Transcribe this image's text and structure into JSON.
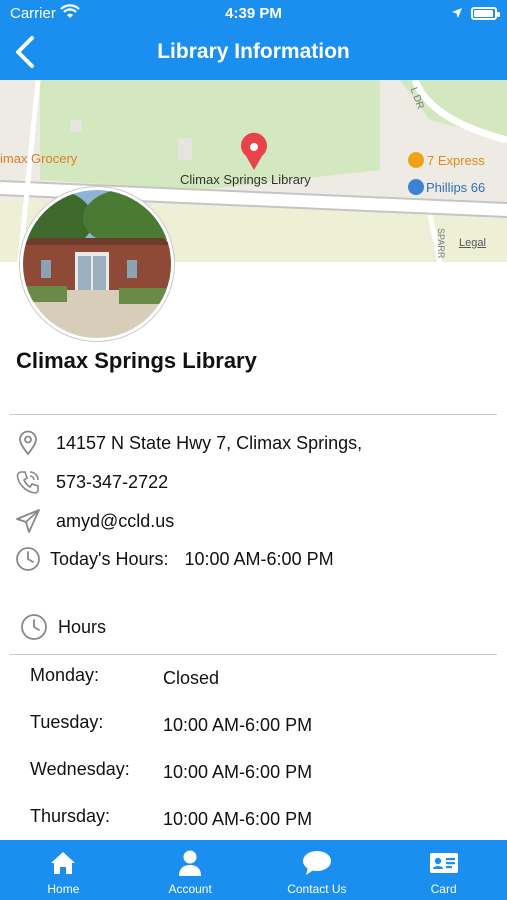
{
  "status_bar": {
    "carrier": "Carrier",
    "time": "4:39 PM",
    "battery_level": 0.95
  },
  "nav": {
    "title": "Library Information",
    "back_icon": "chevron-left-icon"
  },
  "map": {
    "labels": {
      "grocery": "imax Grocery",
      "library": "Climax Springs Library",
      "seven_express": "7 Express",
      "phillips": "Phillips 66",
      "road_dr": "L DR",
      "road_sparr": "SPARR",
      "legal": "Legal"
    },
    "pin_color": "#e8434b"
  },
  "library": {
    "name": "Climax Springs Library",
    "address": "14157 N State Hwy 7, Climax Springs,",
    "phone": "573-347-2722",
    "email": "amyd@ccld.us",
    "todays_hours_label": "Today's Hours:",
    "todays_hours_value": "10:00 AM-6:00 PM"
  },
  "hours": {
    "title": "Hours",
    "days": [
      {
        "day": "Monday:",
        "value": "Closed"
      },
      {
        "day": "Tuesday:",
        "value": "10:00 AM-6:00 PM"
      },
      {
        "day": "Wednesday:",
        "value": "10:00 AM-6:00 PM"
      },
      {
        "day": "Thursday:",
        "value": "10:00 AM-6:00 PM"
      }
    ]
  },
  "tabs": [
    {
      "label": "Home",
      "icon": "home-icon"
    },
    {
      "label": "Account",
      "icon": "person-icon"
    },
    {
      "label": "Contact Us",
      "icon": "chat-bubble-icon"
    },
    {
      "label": "Card",
      "icon": "id-card-icon"
    }
  ],
  "colors": {
    "brand": "#1a8ff0",
    "map_pin": "#e8434b",
    "grocery_label": "#e07b2a",
    "poi_orange": "#f0a31a",
    "poi_blue": "#3b82d6"
  }
}
